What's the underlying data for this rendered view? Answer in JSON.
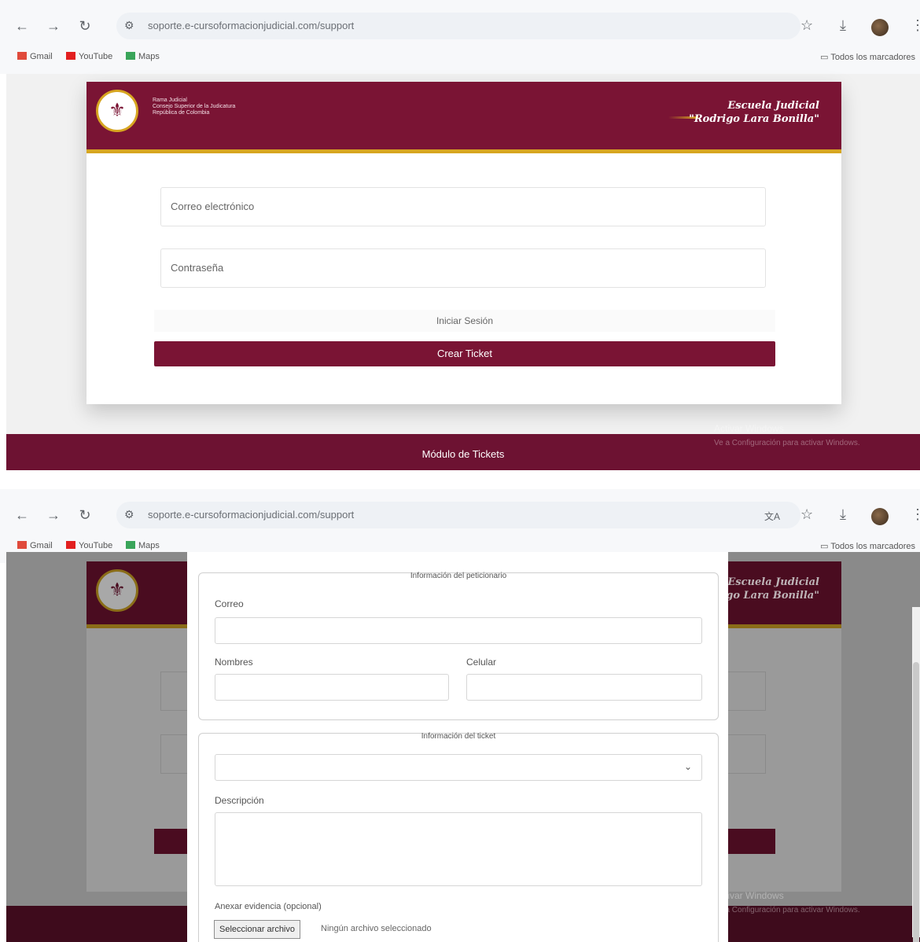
{
  "browser": {
    "url_1": "soporte.e-cursoformacionjudicial.com/support",
    "url_2": "soporte.e-cursoformacionjudicial.com/support",
    "bookmarks": [
      "Gmail",
      "YouTube",
      "Maps"
    ],
    "all_bookmarks": "Todos los marcadores"
  },
  "header": {
    "institution_lines": [
      "Rama Judicial",
      "Consejo Superior de la Judicatura",
      "República de Colombia"
    ],
    "school_line1": "Escuela Judicial",
    "school_line2": "\"Rodrigo Lara Bonilla\"",
    "school_line2_partial": "rigo Lara Bonilla\"",
    "school_line1_partial": "Escuela Judicial"
  },
  "login": {
    "email_placeholder": "Correo electrónico",
    "password_placeholder": "Contraseña",
    "login_button": "Iniciar Sesión",
    "create_ticket_button": "Crear Ticket"
  },
  "footer": {
    "title": "Módulo de Tickets",
    "watermark_title": "Activar Windows",
    "watermark_sub": "Ve a Configuración para activar Windows."
  },
  "modal": {
    "requester_legend": "Información del peticionario",
    "email_label": "Correo",
    "names_label": "Nombres",
    "phone_label": "Celular",
    "ticket_legend": "Información del ticket",
    "description_label": "Descripción",
    "attachment_label": "Anexar evidencia (opcional)",
    "file_button": "Seleccionar archivo",
    "file_status": "Ningún archivo seleccionado"
  },
  "colors": {
    "brand": "#7a1434",
    "accent": "#d7a621"
  }
}
